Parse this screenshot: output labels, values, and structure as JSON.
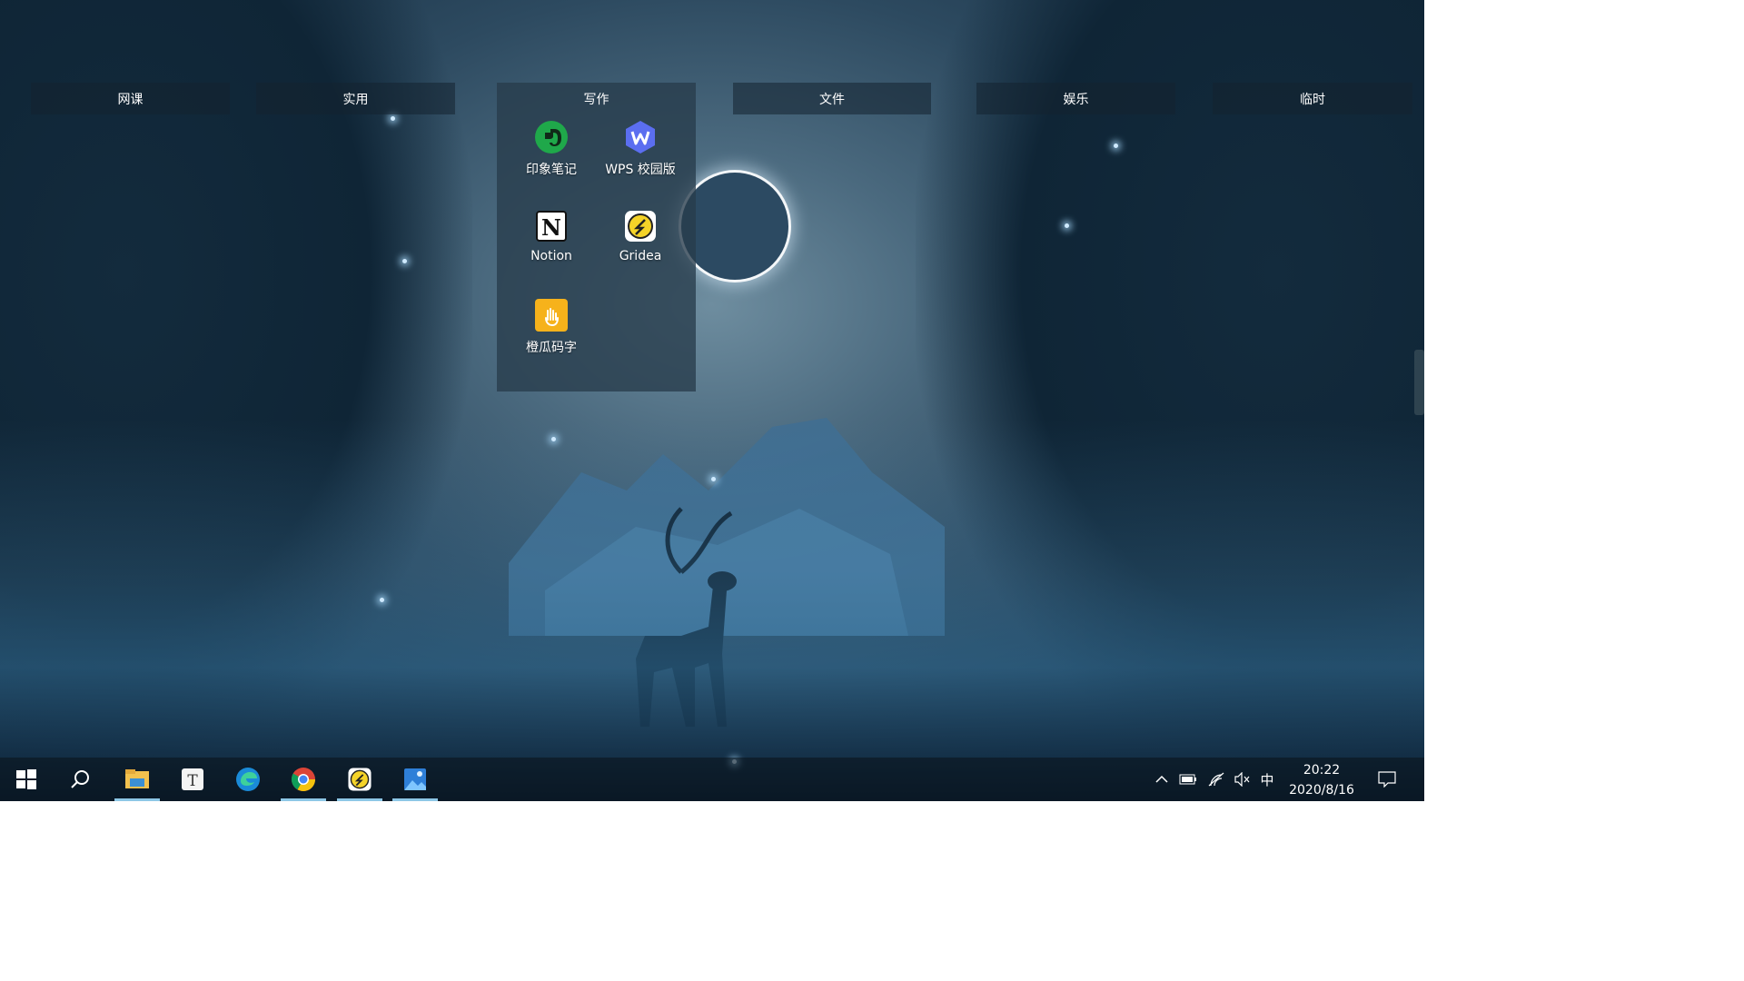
{
  "groups": [
    {
      "label": "网课"
    },
    {
      "label": "实用"
    },
    {
      "label": "写作"
    },
    {
      "label": "文件"
    },
    {
      "label": "娱乐"
    },
    {
      "label": "临时"
    }
  ],
  "open_group": {
    "title": "写作",
    "apps": [
      {
        "label": "印象笔记",
        "icon": "evernote-icon"
      },
      {
        "label": "WPS 校园版",
        "icon": "wps-icon"
      },
      {
        "label": "Notion",
        "icon": "notion-icon"
      },
      {
        "label": "Gridea",
        "icon": "gridea-icon"
      },
      {
        "label": "橙瓜码字",
        "icon": "chenggua-icon"
      }
    ]
  },
  "taskbar": {
    "apps": [
      "start-icon",
      "search-icon",
      "file-explorer-icon",
      "typora-icon",
      "edge-icon",
      "chrome-icon",
      "gridea-icon",
      "photo-app-icon"
    ],
    "tray": {
      "ime": "中",
      "time": "20:22",
      "date": "2020/8/16"
    }
  },
  "colors": {
    "taskbar_active_indicator": "#8dc7e6",
    "panel_bg": "#283c4b"
  }
}
